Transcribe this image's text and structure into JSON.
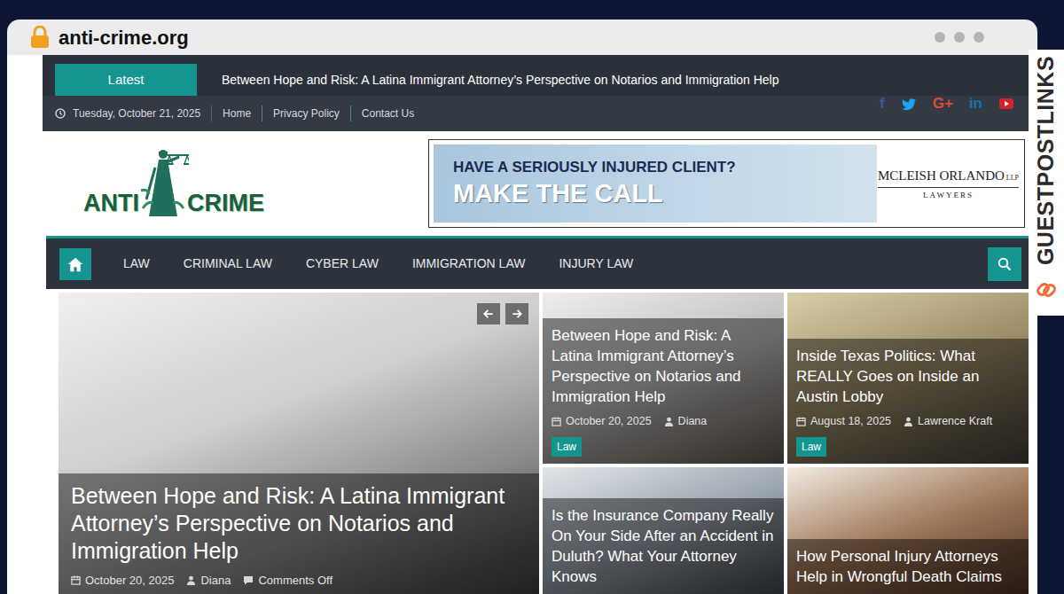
{
  "browser": {
    "url": "anti-crime.org",
    "side_label": "GUESTPOSTLINKS"
  },
  "ticker": {
    "label": "Latest",
    "text": "Between Hope and Risk: A Latina Immigrant Attorney’s Perspective on Notarios and Immigration Help"
  },
  "topbar": {
    "date": "Tuesday, October 21, 2025",
    "links": [
      "Home",
      "Privacy Policy",
      "Contact Us"
    ]
  },
  "social": [
    {
      "kind": "facebook",
      "glyph": "f",
      "color": "#3b5998"
    },
    {
      "kind": "twitter",
      "color": "#1da1f2"
    },
    {
      "kind": "google",
      "glyph": "G+",
      "color": "#dd4b39"
    },
    {
      "kind": "linkedin",
      "glyph": "in",
      "color": "#0e76a8"
    },
    {
      "kind": "youtube",
      "color": "#d8202c"
    }
  ],
  "logo": {
    "words": [
      "ANTI",
      "CRIME"
    ]
  },
  "ad": {
    "line1": "HAVE A SERIOUSLY INJURED CLIENT?",
    "line2": "MAKE THE CALL",
    "brand": "MCLEISH ORLANDO",
    "brand_suffix": "LLP",
    "brand_sub": "LAWYERS"
  },
  "nav": {
    "home": {
      "selected": true
    },
    "items": [
      {
        "label": "LAW",
        "selected": false
      },
      {
        "label": "CRIMINAL LAW",
        "selected": false
      },
      {
        "label": "CYBER LAW",
        "selected": false
      },
      {
        "label": "IMMIGRATION LAW",
        "selected": false
      },
      {
        "label": "INJURY LAW",
        "selected": false
      }
    ]
  },
  "slider": {
    "title": "Between Hope and Risk: A Latina Immigrant Attorney’s Perspective on Notarios and Immigration Help",
    "date": "October 20, 2025",
    "author": "Diana",
    "comments": "Comments Off"
  },
  "cards": [
    {
      "title": "Between Hope and Risk: A Latina Immigrant Attorney’s Perspective on Notarios and Immigration Help",
      "date": "October 20, 2025",
      "author": "Diana",
      "category": "Law"
    },
    {
      "title": "Inside Texas Politics: What REALLY Goes on Inside an Austin Lobby",
      "date": "August 18, 2025",
      "author": "Lawrence Kraft",
      "category": "Law"
    },
    {
      "title": "Is the Insurance Company Really On Your Side After an Accident in Duluth? What Your Attorney Knows"
    },
    {
      "title": "How Personal Injury Attorneys Help in Wrongful Death Claims"
    }
  ]
}
